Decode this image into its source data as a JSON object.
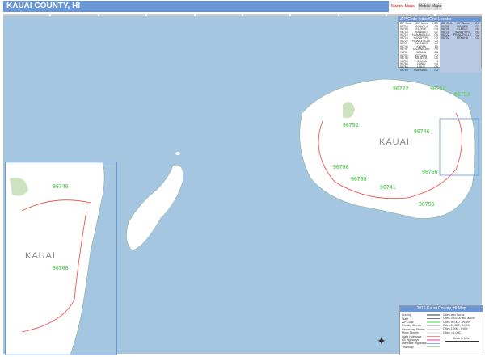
{
  "header": {
    "title": "KAUAI COUNTY, HI",
    "logo_text": "Market Maps",
    "logo_badge": "Mobile Maps"
  },
  "zip_index": {
    "title": "ZIP Code Index/Grid Locator",
    "columns": [
      "ZIP Code",
      "ZIP Name",
      "LOC"
    ],
    "left": [
      [
        "96703",
        "ANAHOLA",
        "C5"
      ],
      [
        "96705",
        "ELEELE",
        "H4"
      ],
      [
        "96714",
        "HANALEI",
        "C2"
      ],
      [
        "96715",
        "HANAMAULU",
        "G5"
      ],
      [
        "96716",
        "HANAPEPE",
        "H3"
      ],
      [
        "96722",
        "PRINCEVILLE",
        "C3"
      ],
      [
        "96741",
        "KALAHEO",
        "H4"
      ],
      [
        "96746",
        "KAPAA",
        "E5"
      ],
      [
        "96747",
        "KAUMAKANI",
        "H4"
      ],
      [
        "96751",
        "KEALIA",
        "D5"
      ],
      [
        "96752",
        "KEKAHA",
        "G2"
      ],
      [
        "96754",
        "KILAUEA",
        "C4"
      ],
      [
        "96756",
        "KOLOA",
        "I4"
      ],
      [
        "96765",
        "LAWAI",
        "H4"
      ],
      [
        "96766",
        "LIHUE",
        "G5"
      ],
      [
        "96769",
        "MAKAWELI",
        "H3"
      ]
    ],
    "right": [
      [
        "96796",
        "WAIMEA",
        "G3"
      ],
      [
        "96705",
        "ELEELE",
        "H4"
      ],
      [
        "96716",
        "HANAPEPE",
        "H3"
      ],
      [
        "96722",
        "PRINCEVILLE",
        "C3"
      ],
      [
        "96752",
        "KEKAHA",
        "G2"
      ]
    ]
  },
  "map": {
    "county_label": "KAUAI",
    "zips": [
      "96722",
      "96754",
      "96703",
      "96752",
      "96746",
      "96796",
      "96769",
      "96741",
      "96766",
      "96756"
    ],
    "inset_zips": [
      "96746",
      "96766"
    ],
    "inset_label": "KAUAI"
  },
  "legend": {
    "title": "2016 Kauai County, HI Map",
    "items": [
      "County",
      "State",
      "ZIP Code",
      "Primary Streets",
      "Secondary Streets",
      "Minor Streets",
      "State Highways",
      "US Highways",
      "Interstate Highways",
      "Township"
    ],
    "cities_title": "Cities and Towns",
    "cities": [
      "Cities 100,000 and above",
      "Cities 50,000 - 99,999",
      "Cities 10,000 - 49,999",
      "Cities 1,000 - 9,999",
      "Cities < 1,000"
    ],
    "scale_label": "Scale in Miles"
  },
  "colors": {
    "header": "#6b97d8",
    "water": "#a5c6e0",
    "land": "#ffffff",
    "zip_label": "#6fcf6f"
  }
}
